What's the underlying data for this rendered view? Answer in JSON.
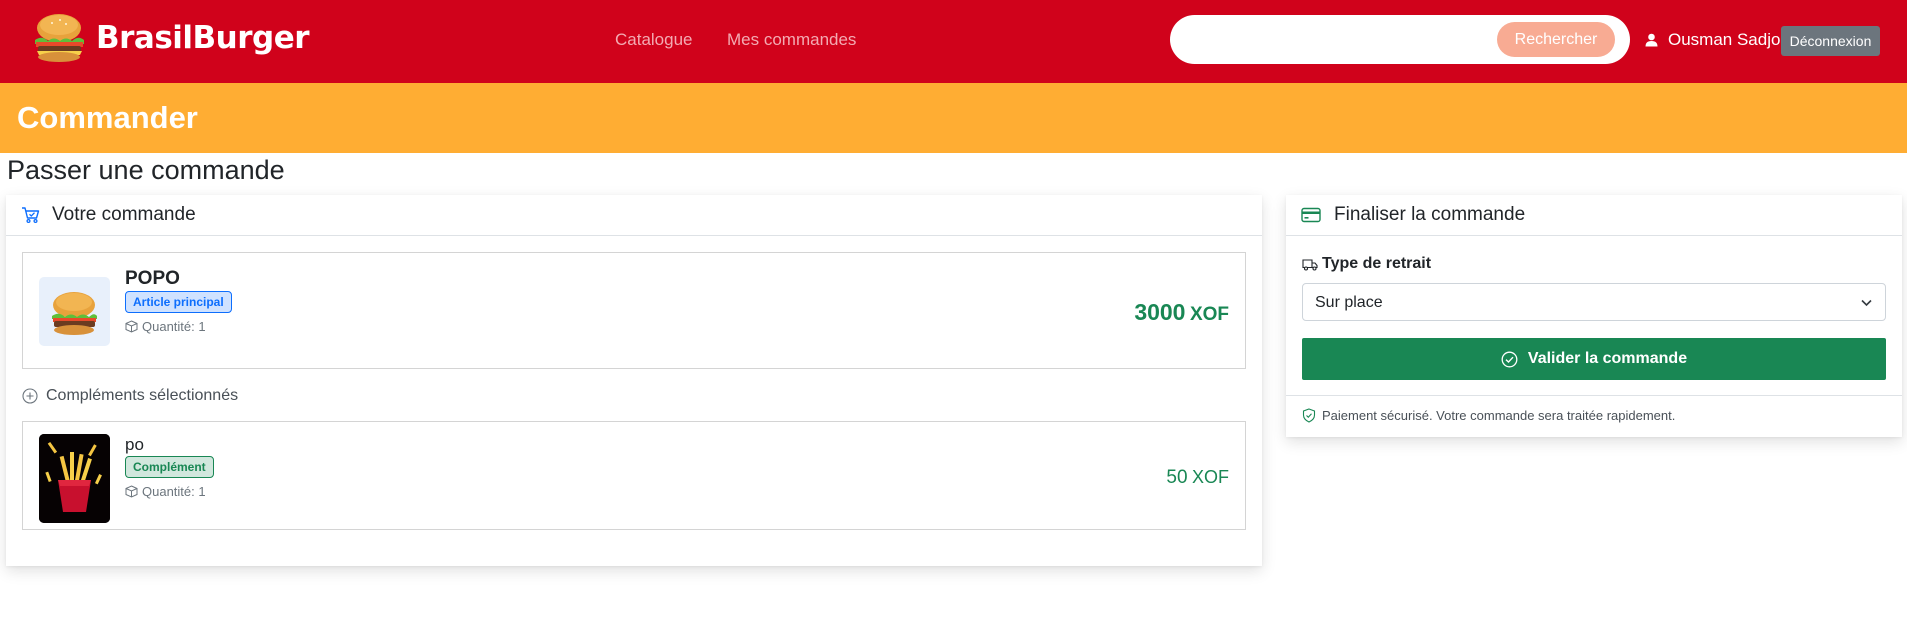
{
  "header": {
    "brand": "BrasilBurger",
    "nav": [
      "Catalogue",
      "Mes commandes"
    ],
    "search": {
      "value": "",
      "placeholder": "",
      "button": "Rechercher"
    },
    "user_name": "Ousman Sadjo",
    "logout": "Déconnexion"
  },
  "banner": {
    "title": "Commander"
  },
  "page": {
    "heading": "Passer une commande"
  },
  "order": {
    "title": "Votre commande",
    "main_item": {
      "name": "POPO",
      "badge": "Article principal",
      "quantity": "Quantité: 1",
      "price": "3000",
      "currency": "XOF"
    },
    "extras_title": "Compléments sélectionnés",
    "extra_item": {
      "name": "po",
      "badge": "Complément",
      "quantity": "Quantité: 1",
      "price": "50",
      "currency": "XOF"
    }
  },
  "finalize": {
    "title": "Finaliser la commande",
    "field_label": "Type de retrait",
    "selected_option": "Sur place",
    "submit": "Valider la commande",
    "note": "Paiement sécurisé. Votre commande sera traitée rapidement."
  },
  "colors": {
    "header_bg": "#d0021b",
    "banner_bg": "#ffad33",
    "price_green": "#198754",
    "primary_blue": "#0d6efd"
  },
  "icons": [
    "burger-logo-icon",
    "user-icon",
    "cart-check-icon",
    "box-icon",
    "plus-circle-icon",
    "credit-card-icon",
    "truck-icon",
    "chevron-down-icon",
    "check-circle-icon",
    "shield-check-icon"
  ]
}
